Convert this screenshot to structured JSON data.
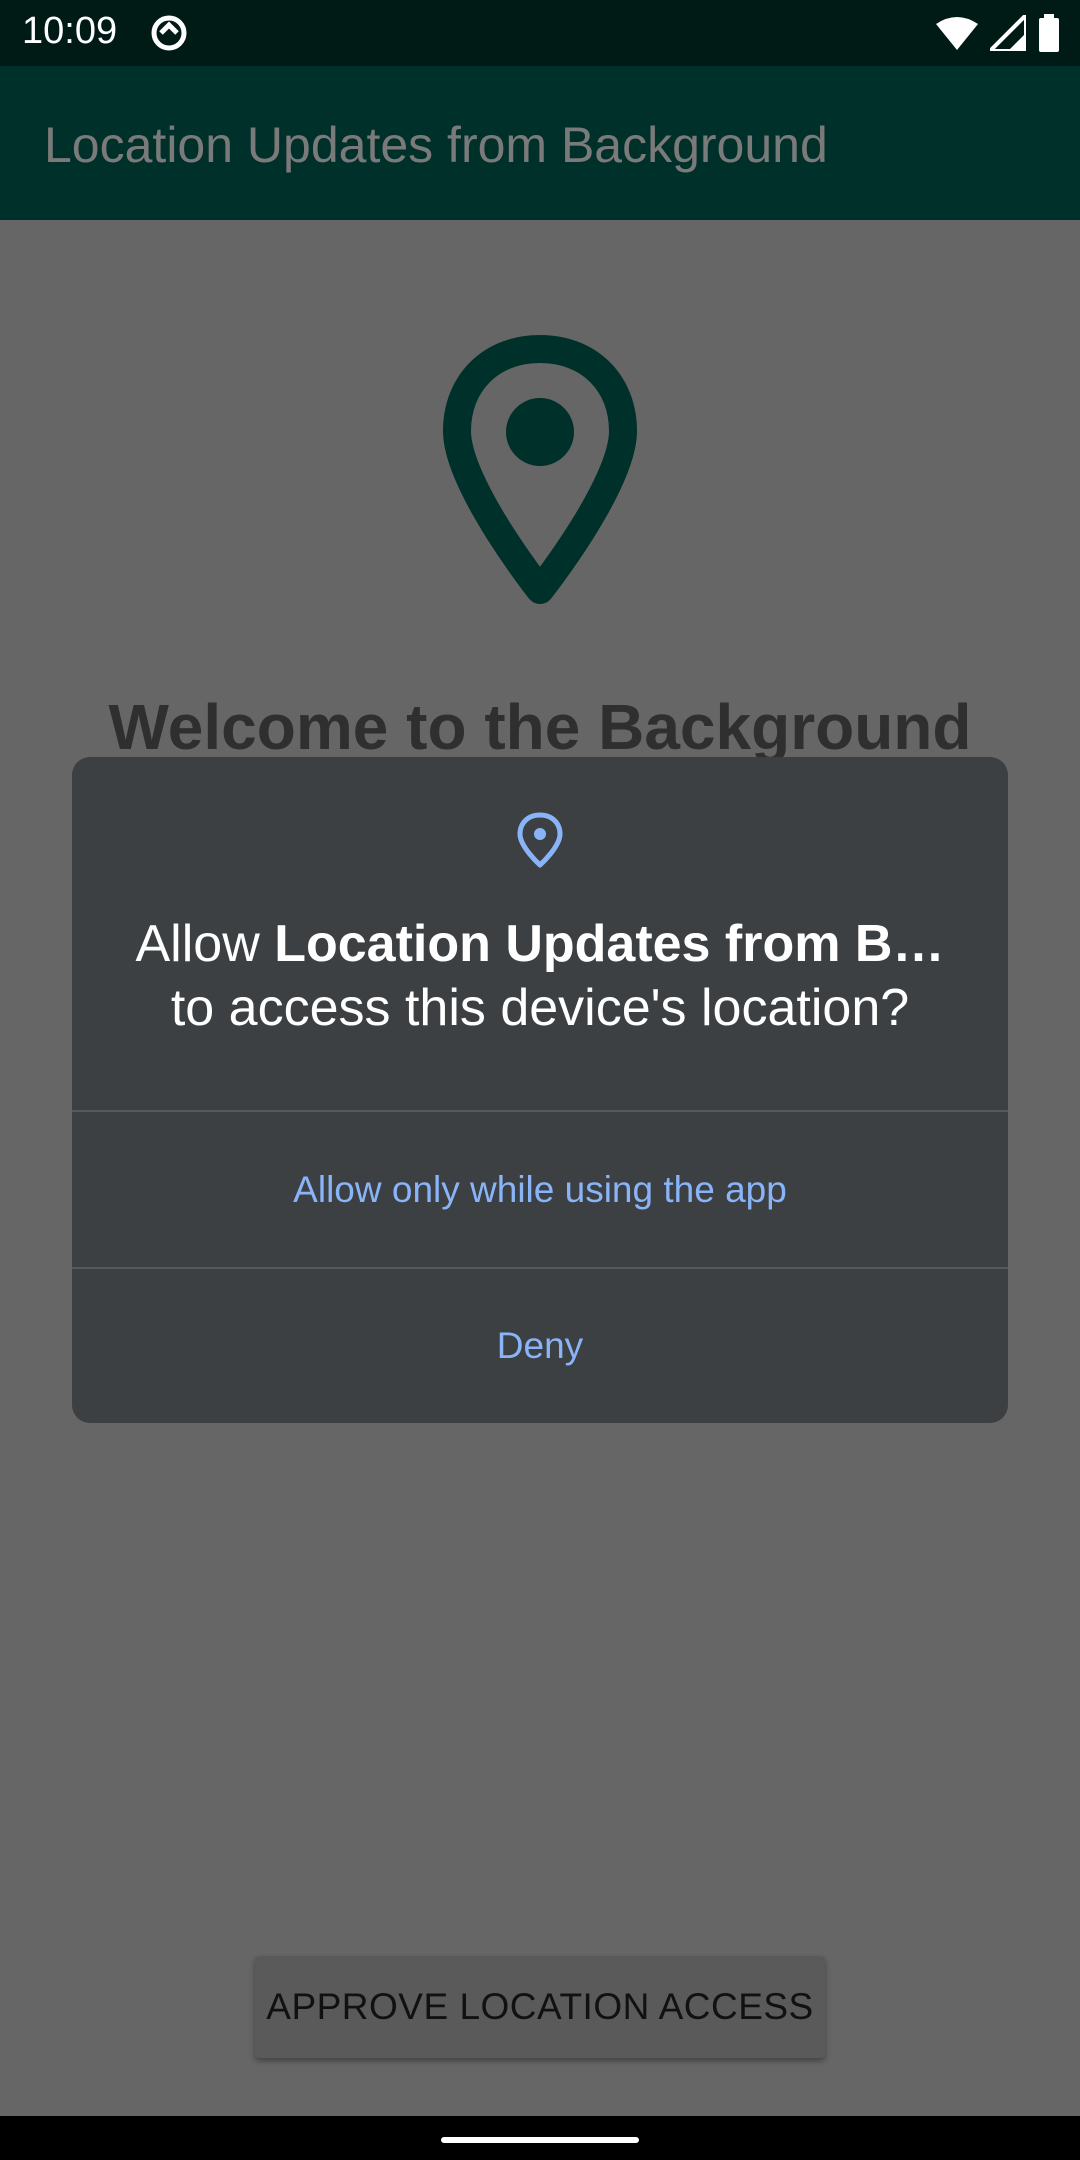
{
  "status_bar": {
    "time": "10:09",
    "icons": [
      "data-saver-icon",
      "wifi-icon",
      "cell-signal-icon",
      "battery-icon"
    ]
  },
  "app_bar": {
    "title": "Location Updates from Background"
  },
  "main": {
    "icon": "location-pin-icon",
    "welcome_text": "Welcome to the Background",
    "approve_button_label": "APPROVE LOCATION ACCESS"
  },
  "dialog": {
    "icon": "location-pin-icon",
    "message_prefix": "Allow ",
    "app_name": "Location Updates from B…",
    "message_suffix": "to access this device's location?",
    "options": [
      {
        "label": "Allow only while using the app"
      },
      {
        "label": "Deny"
      }
    ]
  },
  "colors": {
    "status_bar": "#001a16",
    "app_bar": "#00302a",
    "scrim_background": "#666666",
    "dialog_background": "#3d4043",
    "dialog_accent": "#8ab4f8",
    "pin": "#00302a"
  }
}
